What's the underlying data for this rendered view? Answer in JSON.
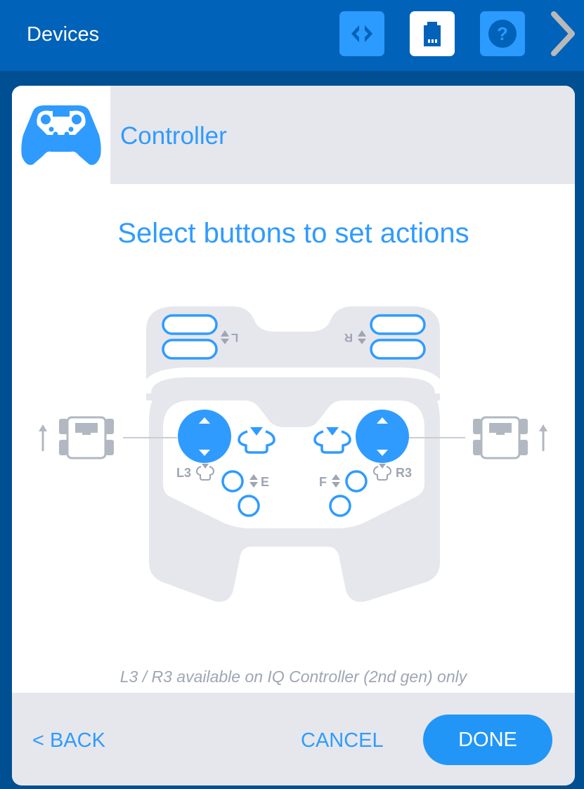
{
  "app": {
    "title": "Devices"
  },
  "toolbar": {
    "buttons": [
      {
        "name": "code-view",
        "icon": "code-brackets-icon",
        "active": false
      },
      {
        "name": "devices",
        "icon": "port-icon",
        "active": true
      },
      {
        "name": "help",
        "icon": "help-icon",
        "active": false
      }
    ],
    "next_icon": "chevron-right-icon"
  },
  "panel": {
    "device_icon": "gamepad-icon",
    "device_name": "Controller",
    "instruction": "Select buttons to set actions",
    "note": "L3 / R3 available on IQ Controller (2nd gen) only"
  },
  "controller": {
    "labels": {
      "left_bumper": "L",
      "right_bumper": "R",
      "left_stick_press": "L3",
      "right_stick_press": "R3",
      "left_buttons": "E",
      "right_buttons": "F"
    }
  },
  "footer": {
    "back_label": "< BACK",
    "cancel_label": "CANCEL",
    "done_label": "DONE"
  },
  "colors": {
    "accent": "#2f9bff",
    "header_bg": "#0062b8",
    "frame_bg": "#004f92",
    "panel_gray": "#e6e7ec",
    "label_gray": "#9ea6b4"
  }
}
